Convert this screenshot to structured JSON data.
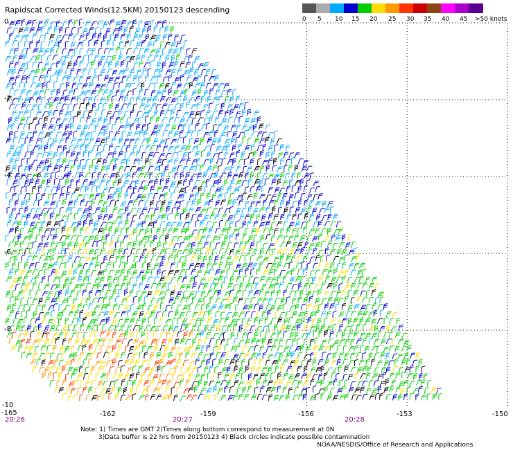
{
  "title": "Rapidscat Corrected Winds(12.5KM) 20150123 descending",
  "scale": {
    "tick_labels": [
      "0",
      "5",
      "10",
      "15",
      "20",
      "25",
      "30",
      "35",
      "40",
      "45",
      ">50 knots"
    ],
    "colors": [
      "#555555",
      "#aaaaaa",
      "#00aaff",
      "#0000cc",
      "#00cc00",
      "#ffdd00",
      "#ff9900",
      "#ff3300",
      "#cc0000",
      "#8b4513",
      "#ff00ff",
      "#aa00cc",
      "#5a0090"
    ]
  },
  "axes": {
    "lat_labels": [
      "0",
      "-2",
      "-4",
      "-6",
      "-8",
      "-10"
    ],
    "lat_values": [
      0,
      -2,
      -4,
      -6,
      -8,
      -10
    ],
    "lon_labels": [
      "-165",
      "-162",
      "-159",
      "-156",
      "-153",
      "-150"
    ],
    "lon_values": [
      -165,
      -162,
      -159,
      -156,
      -153,
      -150
    ],
    "time_labels": [
      "20:26",
      "20:27",
      "20:28"
    ]
  },
  "notes": {
    "line1": "Note: 1) Times are GMT 2)Times along bottom correspond to measurement at 0N",
    "line2": "3)Data buffer is 22 hrs from 20150123 4) Black circles indicate possible contamination"
  },
  "credit": "NOAA/NESDIS/Office of Research and Applications"
}
